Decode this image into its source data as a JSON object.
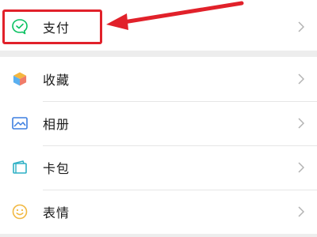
{
  "menu": {
    "pay": {
      "label": "支付",
      "icon": "wechat-pay-icon"
    },
    "items": [
      {
        "label": "收藏",
        "icon": "favorites-cube-icon"
      },
      {
        "label": "相册",
        "icon": "album-picture-icon"
      },
      {
        "label": "卡包",
        "icon": "card-wallet-icon"
      },
      {
        "label": "表情",
        "icon": "emoji-smiley-icon"
      }
    ]
  },
  "colors": {
    "accent_green": "#07c160",
    "highlight_red": "#e1212a",
    "background": "#ededed",
    "row_background": "#ffffff"
  }
}
